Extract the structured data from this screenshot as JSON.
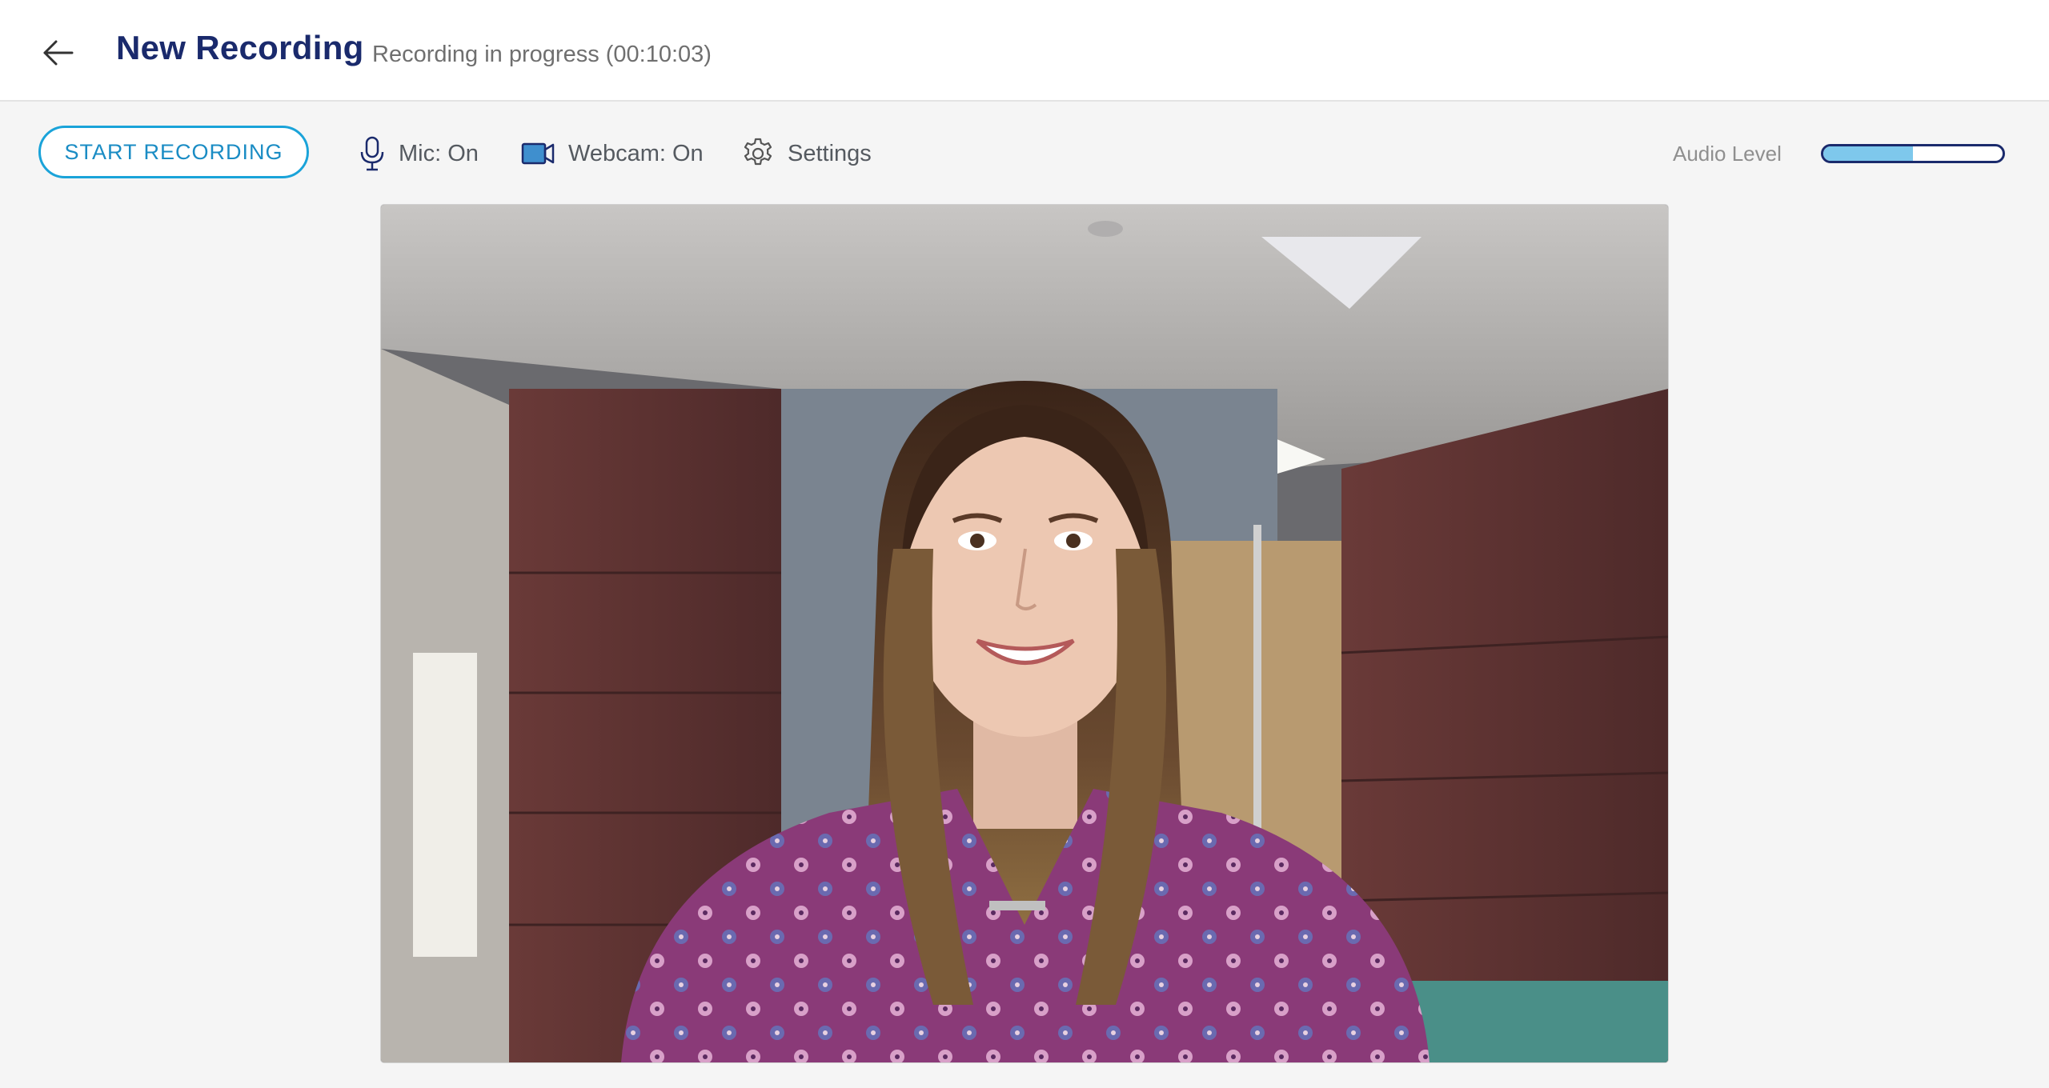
{
  "header": {
    "title": "New Recording",
    "status": "Recording in progress (00:10:03)"
  },
  "toolbar": {
    "start_label": "START RECORDING",
    "mic_label": "Mic: On",
    "webcam_label": "Webcam: On",
    "settings_label": "Settings",
    "audio_level_label": "Audio Level",
    "audio_level_value": 0.5
  },
  "icons": {
    "back": "arrow-left-icon",
    "mic": "microphone-icon",
    "webcam": "video-camera-icon",
    "settings": "gear-icon"
  },
  "colors": {
    "title": "#1a2a6c",
    "accent": "#1aa3d9",
    "meter_fill": "#7ec8ec"
  }
}
